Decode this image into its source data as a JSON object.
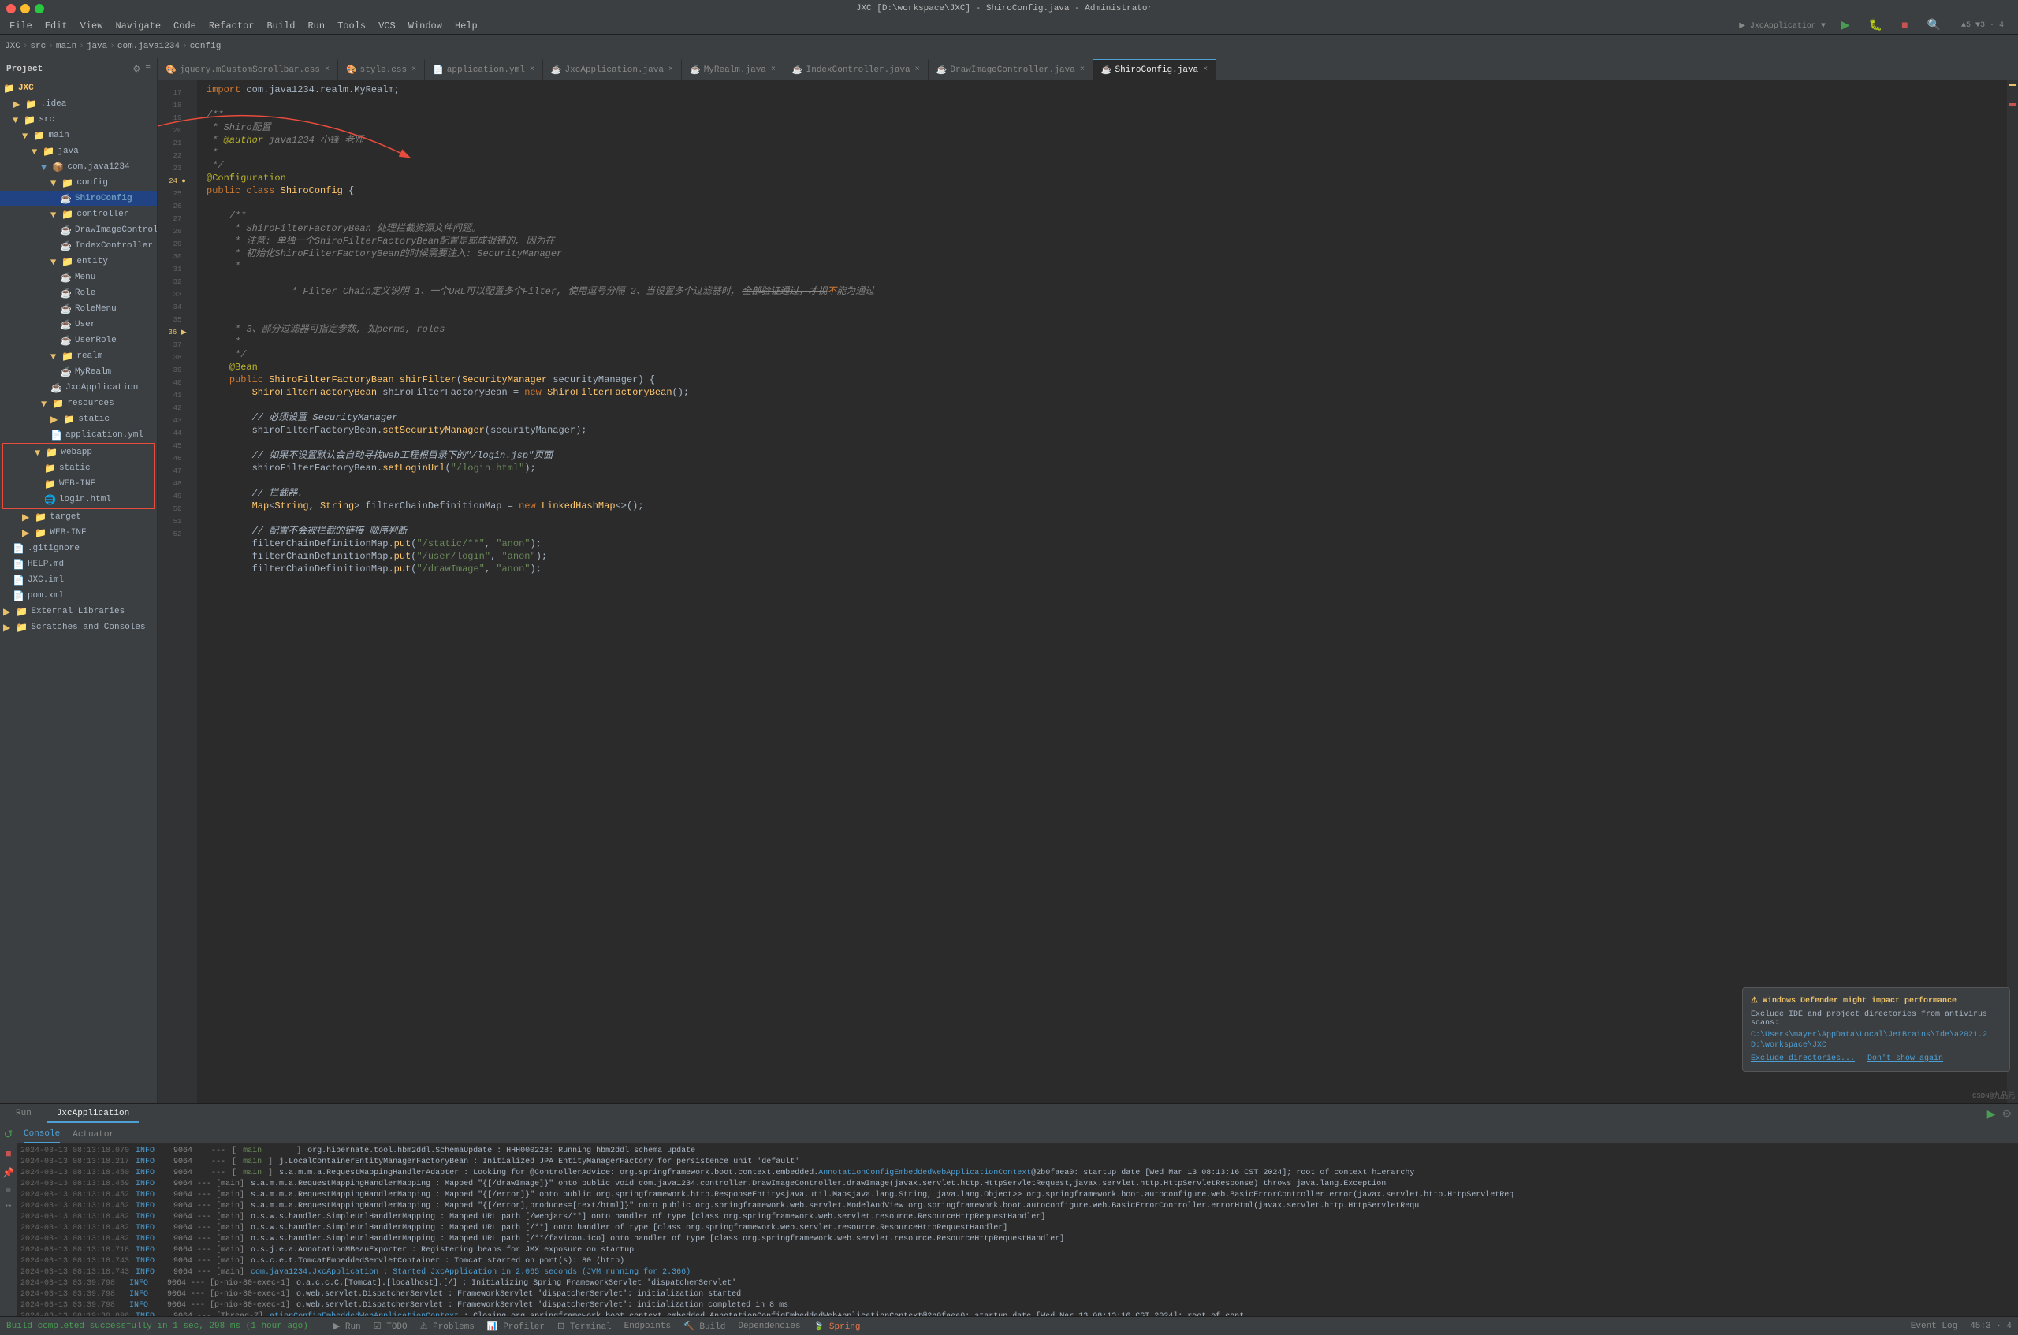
{
  "window": {
    "title": "JXC [D:\\workspace\\JXC] - ShiroConfig.java - Administrator",
    "controls": [
      "close",
      "minimize",
      "maximize"
    ]
  },
  "menubar": {
    "items": [
      "File",
      "Edit",
      "View",
      "Navigate",
      "Code",
      "Refactor",
      "Build",
      "Run",
      "Tools",
      "VCS",
      "Window",
      "Help"
    ]
  },
  "breadcrumb": {
    "parts": [
      "JXC",
      "src",
      "main",
      "java",
      "com.java1234",
      "config"
    ]
  },
  "tabs": [
    {
      "label": "jquery.mCustomScrollbar.css",
      "icon": "css",
      "active": false
    },
    {
      "label": "style.css",
      "icon": "css",
      "active": false
    },
    {
      "label": "application.yml",
      "icon": "yml",
      "active": false
    },
    {
      "label": "JxcApplication.java",
      "icon": "java",
      "active": false
    },
    {
      "label": "MyRealm.java",
      "icon": "java",
      "active": false
    },
    {
      "label": "IndexController.java",
      "icon": "java",
      "active": false
    },
    {
      "label": "DrawImageController.java",
      "icon": "java",
      "active": false
    },
    {
      "label": "ShiroConfig.java",
      "icon": "java",
      "active": true
    }
  ],
  "project_tree": {
    "title": "Project",
    "items": [
      {
        "level": 0,
        "label": "JXC",
        "type": "project",
        "expanded": true
      },
      {
        "level": 1,
        "label": ".idea",
        "type": "folder",
        "expanded": false
      },
      {
        "level": 1,
        "label": "src",
        "type": "folder",
        "expanded": true
      },
      {
        "level": 2,
        "label": "main",
        "type": "folder",
        "expanded": true
      },
      {
        "level": 3,
        "label": "java",
        "type": "folder",
        "expanded": true
      },
      {
        "level": 4,
        "label": "com.java1234",
        "type": "package",
        "expanded": true
      },
      {
        "level": 5,
        "label": "config",
        "type": "folder",
        "expanded": true
      },
      {
        "level": 6,
        "label": "ShiroConfig",
        "type": "java",
        "active": true
      },
      {
        "level": 5,
        "label": "controller",
        "type": "folder",
        "expanded": true
      },
      {
        "level": 6,
        "label": "DrawImageController",
        "type": "java"
      },
      {
        "level": 6,
        "label": "IndexController",
        "type": "java"
      },
      {
        "level": 5,
        "label": "entity",
        "type": "folder",
        "expanded": true
      },
      {
        "level": 6,
        "label": "Menu",
        "type": "java"
      },
      {
        "level": 6,
        "label": "Role",
        "type": "java"
      },
      {
        "level": 6,
        "label": "RoleMenu",
        "type": "java"
      },
      {
        "level": 6,
        "label": "User",
        "type": "java"
      },
      {
        "level": 6,
        "label": "UserRole",
        "type": "java"
      },
      {
        "level": 5,
        "label": "realm",
        "type": "folder",
        "expanded": true
      },
      {
        "level": 6,
        "label": "MyRealm",
        "type": "java"
      },
      {
        "level": 5,
        "label": "JxcApplication",
        "type": "java"
      },
      {
        "level": 4,
        "label": "resources",
        "type": "folder",
        "expanded": true
      },
      {
        "level": 5,
        "label": "static",
        "type": "folder",
        "expanded": false
      },
      {
        "level": 5,
        "label": "application.yml",
        "type": "yml"
      },
      {
        "level": 3,
        "label": "webapp",
        "type": "folder",
        "expanded": true,
        "highlighted": true
      },
      {
        "level": 4,
        "label": "static",
        "type": "folder",
        "highlighted": true
      },
      {
        "level": 4,
        "label": "WEB-INF",
        "type": "folder",
        "highlighted": true
      },
      {
        "level": 4,
        "label": "login.html",
        "type": "html",
        "highlighted": true
      },
      {
        "level": 2,
        "label": "target",
        "type": "folder",
        "expanded": false
      },
      {
        "level": 2,
        "label": "WEB-INF",
        "type": "folder",
        "expanded": false
      },
      {
        "level": 1,
        "label": ".gitignore",
        "type": "file"
      },
      {
        "level": 1,
        "label": "HELP.md",
        "type": "file"
      },
      {
        "level": 1,
        "label": "JXC.iml",
        "type": "file"
      },
      {
        "level": 1,
        "label": "pom.xml",
        "type": "xml"
      },
      {
        "level": 0,
        "label": "External Libraries",
        "type": "folder",
        "expanded": false
      },
      {
        "level": 0,
        "label": "Scratches and Consoles",
        "type": "folder",
        "expanded": false
      }
    ]
  },
  "code": {
    "lines": [
      {
        "num": "",
        "text": "import com.java1234.realm.MyRealm;"
      },
      {
        "num": "",
        "text": ""
      },
      {
        "num": "",
        "text": "/**"
      },
      {
        "num": "",
        "text": " * Shiro配置"
      },
      {
        "num": "",
        "text": " * @author java1234 小锋 老师"
      },
      {
        "num": "",
        "text": " *"
      },
      {
        "num": "",
        "text": " */"
      },
      {
        "num": "24",
        "text": "@Configuration"
      },
      {
        "num": "25",
        "text": "public class ShiroConfig {"
      },
      {
        "num": "",
        "text": ""
      },
      {
        "num": "",
        "text": "    /**"
      },
      {
        "num": "",
        "text": "     * ShiroFilterFactoryBean 处理拦截资源文件问题。"
      },
      {
        "num": "",
        "text": "     * 注意: 单独一个ShiroFilterFactoryBean配置是或成报错的, 因为在"
      },
      {
        "num": "",
        "text": "     * 初始化ShiroFilterFactoryBean的时候需要注入: SecurityManager"
      },
      {
        "num": "",
        "text": "     *"
      },
      {
        "num": "",
        "text": "     * Filter Chain定义说明 1、一个URL可以配置多个Filter, 使用逗号分隔 2、当设置多个过滤器时, 全部验证通过，才视为通过"
      },
      {
        "num": "",
        "text": "     * 3、部分过滤器可指定参数, 如perms, roles"
      },
      {
        "num": "",
        "text": "     *"
      },
      {
        "num": "",
        "text": "     */"
      },
      {
        "num": "",
        "text": "    @Bean"
      },
      {
        "num": "36",
        "text": "    public ShiroFilterFactoryBean shirFilter(SecurityManager securityManager) {"
      },
      {
        "num": "37",
        "text": "        ShiroFilterFactoryBean shiroFilterFactoryBean = new ShiroFilterFactoryBean();"
      },
      {
        "num": "",
        "text": ""
      },
      {
        "num": "39",
        "text": "        // 必须设置 SecurityManager"
      },
      {
        "num": "40",
        "text": "        shiroFilterFactoryBean.setSecurityManager(securityManager);"
      },
      {
        "num": "",
        "text": ""
      },
      {
        "num": "42",
        "text": "        // 如果不设置默认会自动寻找Web工程根目录下的\"/login.jsp\"页面"
      },
      {
        "num": "43",
        "text": "        shiroFilterFactoryBean.setLoginUrl(\"/login.html\");"
      },
      {
        "num": "",
        "text": ""
      },
      {
        "num": "",
        "text": "        // 拦截器."
      },
      {
        "num": "46",
        "text": "        Map<String, String> filterChainDefinitionMap = new LinkedHashMap<>();"
      },
      {
        "num": "",
        "text": ""
      },
      {
        "num": "",
        "text": "        // 配置不会被拦截的链接 顺序判断"
      },
      {
        "num": "49",
        "text": "        filterChainDefinitionMap.put(\"/static/**\", \"anon\");"
      },
      {
        "num": "50",
        "text": "        filterChainDefinitionMap.put(\"/user/login\", \"anon\");"
      },
      {
        "num": "51",
        "text": "        filterChainDefinitionMap.put(\"/drawImage\", \"anon\");"
      }
    ]
  },
  "run_panel": {
    "app_name": "JxcApplication",
    "tabs": [
      "Run",
      "JxcApplication"
    ],
    "sub_tabs": [
      "Console",
      "Actuator"
    ],
    "logs": [
      {
        "time": "2024-03-13 08:13:18.070",
        "level": "INFO",
        "pid": "9064",
        "thread": "main",
        "msg": "org.hibernate.tool.hbm2ddl.SchemaUpdate : HHH000228: Running hbm2ddl schema update"
      },
      {
        "time": "2024-03-13 08:13:18.217",
        "level": "INFO",
        "pid": "9064",
        "thread": "main",
        "msg": "j.LocalContainerEntityManagerFactoryBean : Initialized JPA EntityManagerFactory for persistence unit 'default'"
      },
      {
        "time": "2024-03-13 08:13:18.450",
        "level": "INFO",
        "pid": "9064",
        "thread": "main",
        "msg": "s.a.m.m.a.RequestMappingHandlerAdapter : Looking for @ControllerAdvice: org.springframework.boot.context.embedded.AnnotationConfigEmbeddedWebApplicationContext@2b0faea0: startup date [Wed Mar 13 08:13:16 CST 2024]; root of context hierarchy"
      },
      {
        "time": "2024-03-13 08:13:18.459",
        "level": "INFO",
        "pid": "9064",
        "thread": "main",
        "msg": "s.a.m.m.a.RequestMappingHandlerMapping : Mapped \"{[/drawImage]}\" onto public void com.java1234.controller.DrawImageController.drawImage(javax.servlet.http.HttpServletRequest,javax.servlet.http.HttpServletResponse) throws java.lang.Exception"
      },
      {
        "time": "2024-03-13 08:13:18.452",
        "level": "INFO",
        "pid": "9064",
        "thread": "main",
        "msg": "s.a.m.m.a.RequestMappingHandlerMapping : Mapped \"{[/error]}\" onto public org.springframework.http.ResponseEntity<java.util.Map<java.lang.String, java.lang.Object>> org.springframework.boot.autoconfigure.web.BasicErrorController.error(javax.servlet.http.HttpServletReq"
      },
      {
        "time": "2024-03-13 08:13:18.452",
        "level": "INFO",
        "pid": "9064",
        "thread": "main",
        "msg": "s.a.m.m.a.RequestMappingHandlerMapping : Mapped \"{[/error],produces=[text/html]}\" onto public org.springframework.web.servlet.ModelAndView org.springframework.boot.autoconfigure.web.BasicErrorController.errorHtml(javax.servlet.http.HttpServletRequ"
      },
      {
        "time": "2024-03-13 08:13:18.482",
        "level": "INFO",
        "pid": "9064",
        "thread": "main",
        "msg": "o.s.w.s.handler.SimpleUrlHandlerMapping : Mapped URL path [/webjars/**] onto handler of type [class org.springframework.web.servlet.resource.ResourceHttpRequestHandler]"
      },
      {
        "time": "2024-03-13 08:13:18.482",
        "level": "INFO",
        "pid": "9064",
        "thread": "main",
        "msg": "o.s.w.s.handler.SimpleUrlHandlerMapping : Mapped URL path [/**] onto handler of type [class org.springframework.web.servlet.resource.ResourceHttpRequestHandler]"
      },
      {
        "time": "2024-03-13 08:13:18.482",
        "level": "INFO",
        "pid": "9064",
        "thread": "main",
        "msg": "o.s.w.s.handler.SimpleUrlHandlerMapping : Mapped URL path [/**/favicon.ico] onto handler of type [class org.springframework.web.servlet.resource.ResourceHttpRequestHandler]"
      },
      {
        "time": "2024-03-13 08:13:18.718",
        "level": "INFO",
        "pid": "9064",
        "thread": "main",
        "msg": "o.s.j.e.a.AnnotationMBeanExporter : Registering beans for JMX exposure on startup"
      },
      {
        "time": "2024-03-13 08:13:18.743",
        "level": "INFO",
        "pid": "9064",
        "thread": "main",
        "msg": "o.s.c.e.t.TomcatEmbeddedServletContainer : Tomcat started on port(s): 80 (http)"
      },
      {
        "time": "2024-03-13 08:13:18.743",
        "level": "INFO",
        "pid": "9064",
        "thread": "main",
        "msg": "com.java1234.JxcApplication : Started JxcApplication in 2.065 seconds (JVM running for 2.366)"
      },
      {
        "time": "2024-03-13 03:39:798",
        "level": "INFO",
        "pid": "9064",
        "thread": "p-nio-80-exec-1",
        "msg": "o.a.c.c.C.[Tomcat].[localhost].[/] : Initializing Spring FrameworkServlet 'dispatcherServlet'"
      },
      {
        "time": "2024-03-13 03:39.798",
        "level": "INFO",
        "pid": "9064",
        "thread": "p-nio-80-exec-1",
        "msg": "o.web.servlet.DispatcherServlet : FrameworkServlet 'dispatcherServlet': initialization started"
      },
      {
        "time": "2024-03-13 03:39.798",
        "level": "INFO",
        "pid": "9064",
        "thread": "p-nio-80-exec-1",
        "msg": "o.web.servlet.DispatcherServlet : FrameworkServlet 'dispatcherServlet': initialization completed in 8 ms"
      },
      {
        "time": "2024-03-13 08:19:30.896",
        "level": "INFO",
        "pid": "9064",
        "thread": "Thread-7",
        "msg": "ationConfigEmbeddedWebApplicationContext : Closing org.springframework.boot.context.embedded.AnnotationConfigEmbeddedWebApplicationContext@2b0faea0: startup date [Wed Mar 13 08:13:16 CST 2024]; root of cont..."
      }
    ]
  },
  "status_bar": {
    "build_msg": "Build completed successfully in 1 sec, 298 ms (1 hour ago)",
    "items": [
      "Run",
      "TODO",
      "Problems",
      "Profiler",
      "Terminal",
      "Endpoints",
      "Build",
      "Dependencies",
      "Spring"
    ],
    "event_log": "Event Log",
    "right_info": "45:3 · 4"
  },
  "notification": {
    "title": "Windows Defender might impact performance",
    "body": "Exclude IDE and project directories from antivirus scans:",
    "path1": "C:\\Users\\mayer\\AppData\\Local\\JetBrains\\Ide\\a2021.2",
    "path2": "D:\\workspace\\JXC",
    "link1": "Exclude directories...",
    "link2": "Don't show again"
  }
}
